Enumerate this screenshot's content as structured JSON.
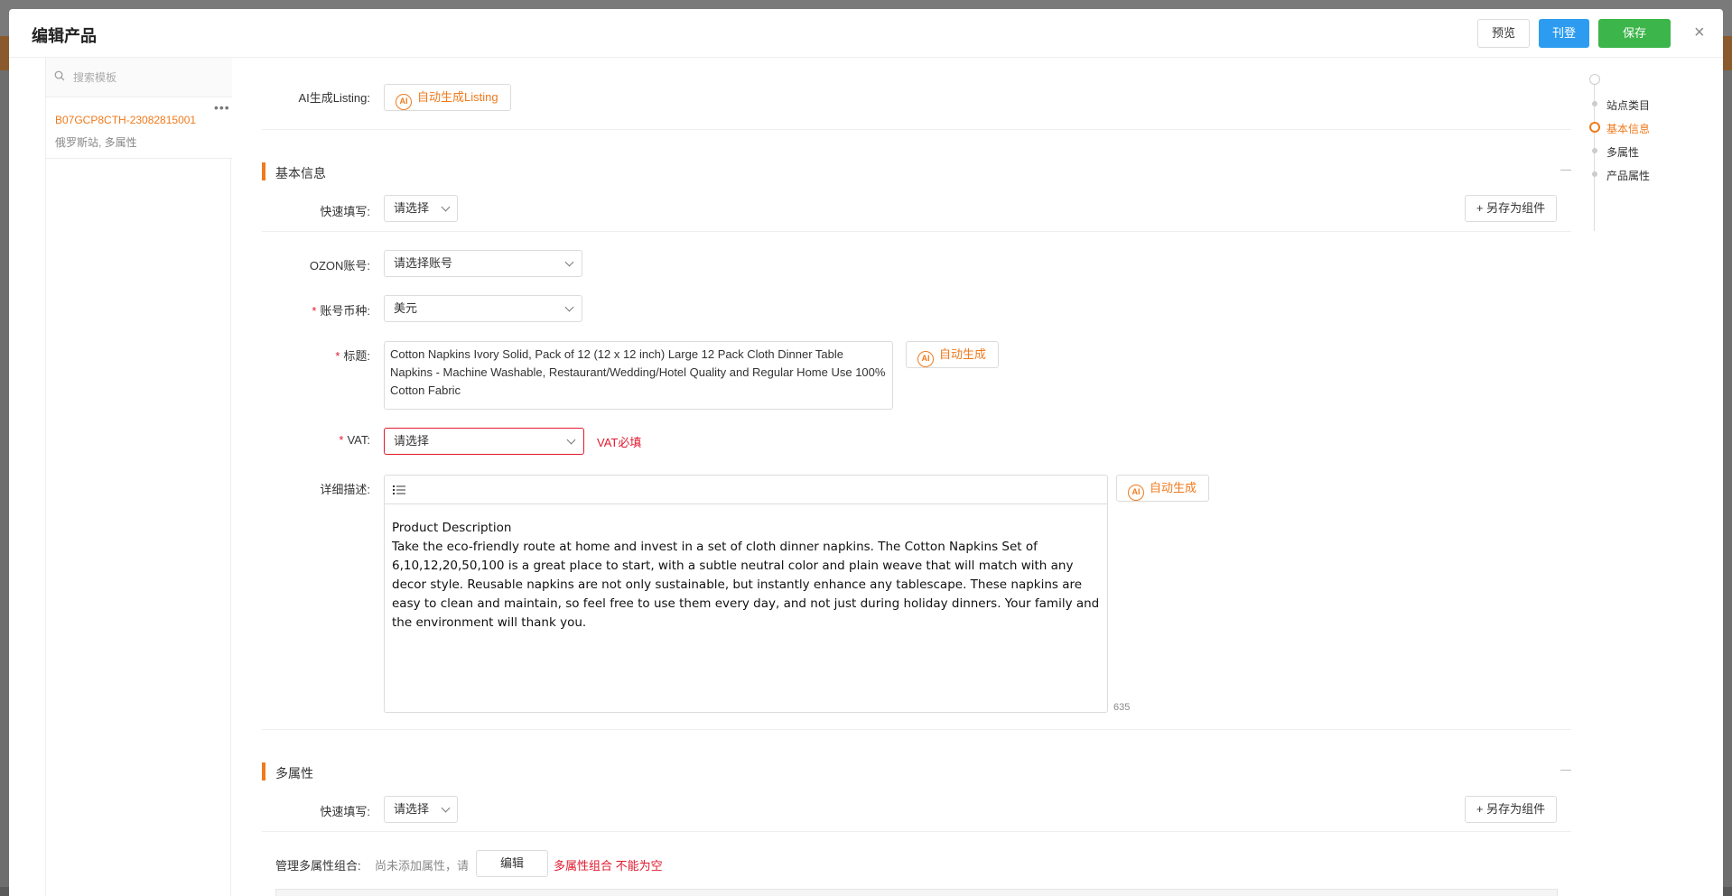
{
  "modal": {
    "title": "编辑产品",
    "preview_label": "预览",
    "publish_label": "刊登",
    "save_label": "保存",
    "close_symbol": "×"
  },
  "left_panel": {
    "search_placeholder": "搜索模板",
    "more_symbol": "•••",
    "template": {
      "name": "B07GCP8CTH-23082815001",
      "sub": "俄罗斯站, 多属性"
    }
  },
  "form": {
    "ai_listing_label": "AI生成Listing:",
    "ai_listing_button": "自动生成Listing",
    "ai_badge": "AI",
    "basic_section_title": "基本信息",
    "quick_fill_label": "快速填写:",
    "quick_fill_value": "请选择",
    "save_component_label": "+ 另存为组件",
    "ozon_account_label": "OZON账号:",
    "ozon_account_placeholder": "请选择账号",
    "currency_label": "账号币种:",
    "currency_value": "美元",
    "title_label": "标题:",
    "title_value": "Cotton Napkins Ivory Solid, Pack of 12 (12 x 12 inch) Large 12 Pack Cloth Dinner Table Napkins - Machine Washable, Restaurant/Wedding/Hotel Quality and Regular Home Use 100% Cotton Fabric",
    "auto_generate_label": "自动生成",
    "vat_label": "VAT:",
    "vat_value": "请选择",
    "vat_error": "VAT必填",
    "description_label": "详细描述:",
    "description_heading": "Product Description",
    "description_body": "Take the eco-friendly route at home and invest in a set of cloth dinner napkins. The Cotton Napkins Set of 6,10,12,20,50,100 is a great place to start, with a subtle neutral color and plain weave that will match with any decor style. Reusable napkins are not only sustainable, but instantly enhance any tablescape. These napkins are easy to clean and maintain, so feel free to use them every day, and not just during holiday dinners. Your family and the environment will thank you.",
    "description_count": "635",
    "variants_section_title": "多属性",
    "manage_variants_label": "管理多属性组合:",
    "manage_variants_hint": "尚未添加属性，请",
    "edit_label": "编辑",
    "variants_error": "多属性组合 不能为空"
  },
  "anchor_nav": {
    "items": [
      {
        "label": "站点类目",
        "active": false
      },
      {
        "label": "基本信息",
        "active": true
      },
      {
        "label": "多属性",
        "active": false
      },
      {
        "label": "产品属性",
        "active": false
      }
    ]
  },
  "colors": {
    "accent": "#f07a1c",
    "publish": "#2d9cf0",
    "save": "#3cb54a",
    "error": "#e0192e"
  }
}
